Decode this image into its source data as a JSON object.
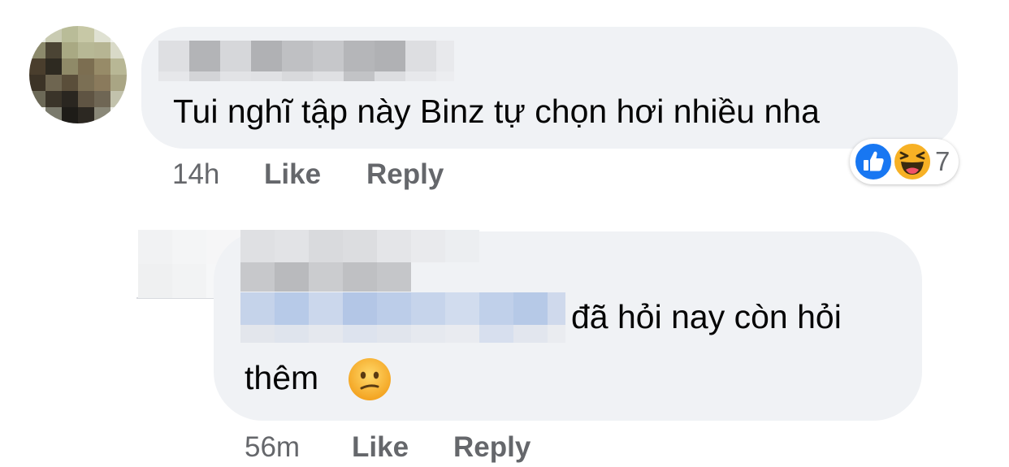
{
  "comment": {
    "text": "Tui nghĩ tập này Binz tự chọn hơi nhiều nha",
    "time": "14h",
    "like_label": "Like",
    "reply_label": "Reply",
    "reactions": {
      "icons": [
        "like-icon",
        "haha-icon"
      ],
      "count": "7"
    }
  },
  "reply": {
    "text_line1": "đã hỏi nay còn hỏi",
    "text_line2": "thêm",
    "emoji": "confused-face-icon",
    "time": "56m",
    "like_label": "Like",
    "reply_label": "Reply"
  },
  "colors": {
    "bubble": "#f0f2f5",
    "meta_text": "#65676b",
    "text": "#050505",
    "like_blue": "#1877f2",
    "haha_yellow": "#f7b125"
  }
}
